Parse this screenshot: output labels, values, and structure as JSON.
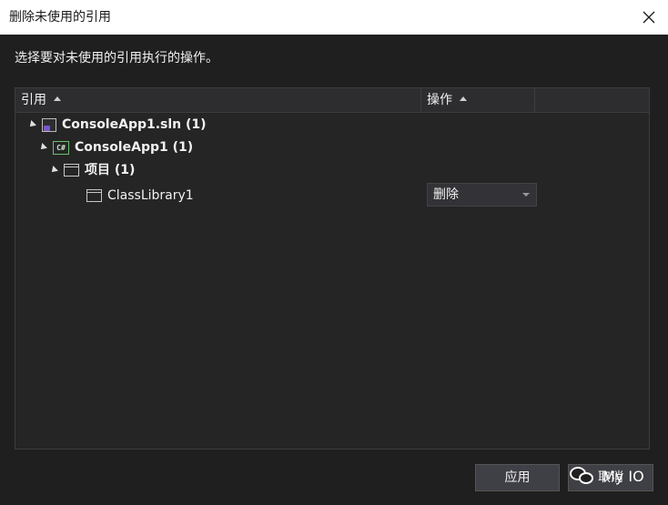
{
  "window": {
    "title": "删除未使用的引用",
    "close_icon": "close-icon"
  },
  "instruction": "选择要对未使用的引用执行的操作。",
  "grid": {
    "columns": [
      {
        "label": "引用",
        "sort": "ascending"
      },
      {
        "label": "操作",
        "sort": "ascending"
      }
    ],
    "tree": {
      "solution": {
        "label": "ConsoleApp1.sln (1)",
        "icon": "solution-icon"
      },
      "project": {
        "label": "ConsoleApp1 (1)",
        "icon": "csharp-project-icon",
        "icon_text": "C#"
      },
      "group": {
        "label": "项目 (1)",
        "icon": "project-reference-icon"
      },
      "item": {
        "label": "ClassLibrary1",
        "icon": "project-reference-icon",
        "action": "删除"
      }
    }
  },
  "buttons": {
    "apply": "应用",
    "cancel": "取消"
  },
  "watermark": {
    "text": "My IO",
    "icon": "wechat-icon"
  }
}
